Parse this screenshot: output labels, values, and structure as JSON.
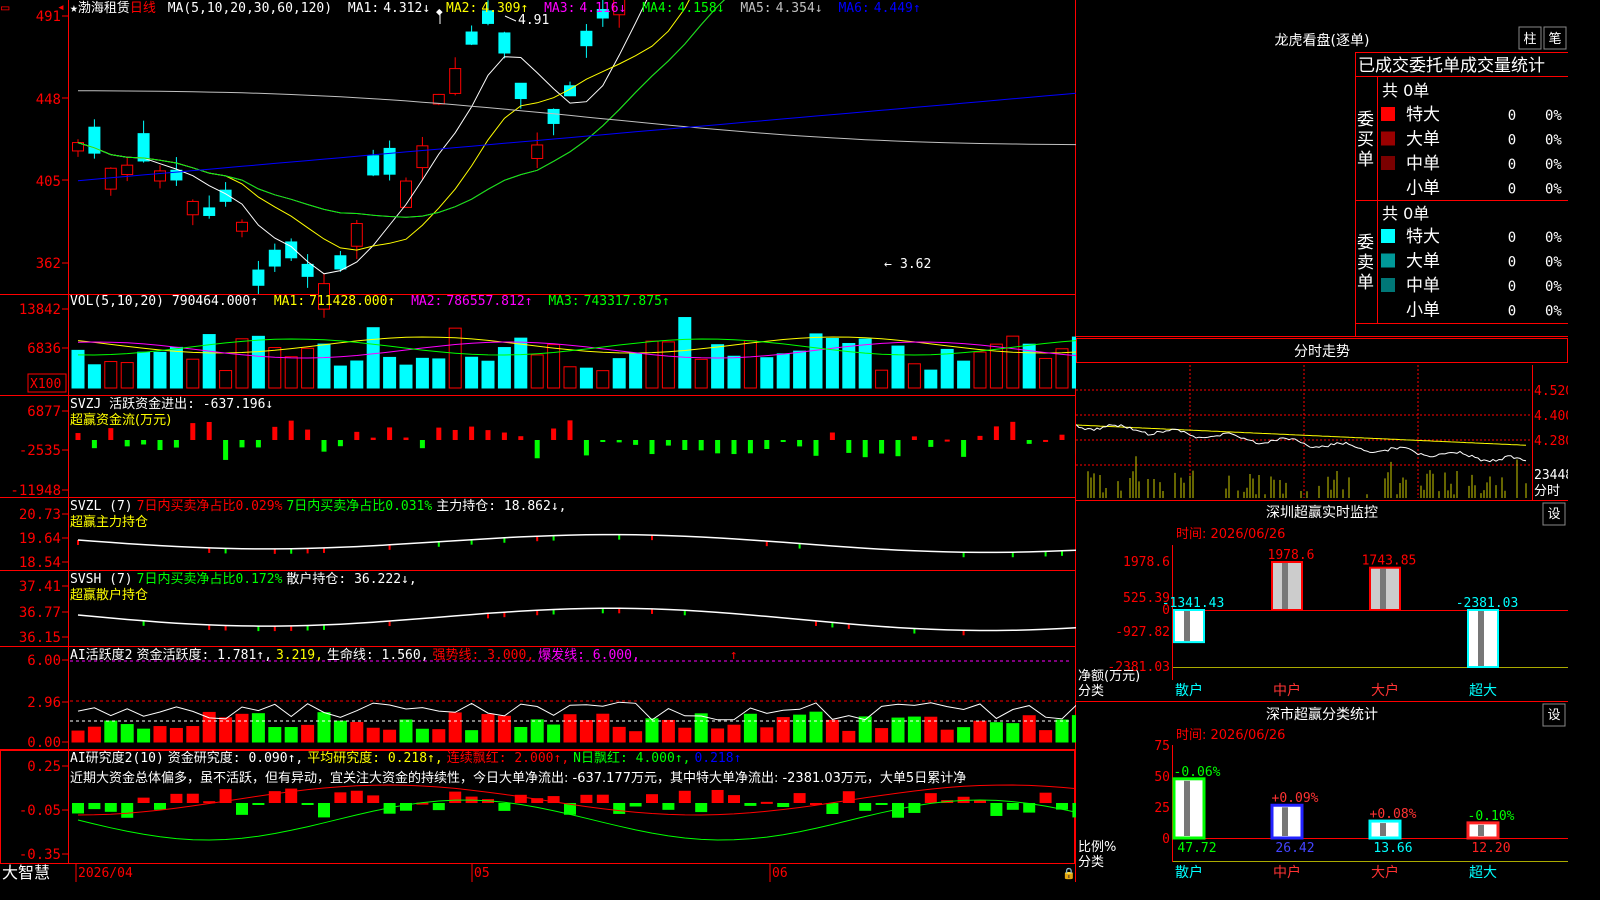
{
  "app": {
    "brand": "大智慧",
    "date_marker": "2026/04",
    "month_labels": [
      "05",
      "06"
    ],
    "star": "★"
  },
  "colors": {
    "up": "#ff0000",
    "down": "#00ffff",
    "ma1": "#ffffff",
    "ma2": "#ffff00",
    "ma3": "#ff00ff",
    "ma4": "#00ff00",
    "ma5": "#c0c0c0",
    "ma6": "#0000ff",
    "frame": "#ff0000",
    "axis": "#ff0000",
    "green": "#00ff00"
  },
  "main": {
    "title": "渤海租赁",
    "period": "日线",
    "ma_params": "MA(5,10,20,30,60,120)",
    "ma": [
      {
        "label": "MA1:",
        "value": "4.312↓"
      },
      {
        "label": "MA2:",
        "value": "4.309↑"
      },
      {
        "label": "MA3:",
        "value": "4.116↓"
      },
      {
        "label": "MA4:",
        "value": "4.158↓"
      },
      {
        "label": "MA5:",
        "value": "4.354↓"
      },
      {
        "label": "MA6:",
        "value": "4.449↑"
      }
    ],
    "y_ticks": [
      "491",
      "448",
      "405",
      "362"
    ],
    "high_label": "4.91",
    "low_label": "3.62"
  },
  "vol": {
    "title": "VOL(5,10,20)",
    "value": "790464.000↑",
    "ma": [
      {
        "label": "MA1:",
        "value": "711428.000↑"
      },
      {
        "label": "MA2:",
        "value": "786557.812↑"
      },
      {
        "label": "MA3:",
        "value": "743317.875↑"
      }
    ],
    "y_ticks": [
      "13842",
      "6836"
    ],
    "unit": "X100"
  },
  "svzj": {
    "line1": "SVZJ  活跃资金进出: -637.196↓",
    "line2": "超赢资金流(万元)",
    "y_ticks": [
      "6877",
      "-2535",
      "-11948"
    ]
  },
  "svzl": {
    "name": "SVZL (7)",
    "p1": "7日内买卖净占比0.029%",
    "p2": "7日内买卖净占比0.031%",
    "p3": "主力持仓: 18.862↓,",
    "line2": "超赢主力持仓",
    "y_ticks": [
      "20.73",
      "19.64",
      "18.54"
    ]
  },
  "svsh": {
    "name": "SVSH (7)",
    "p1": "7日内买卖净占比0.172%",
    "p2": "散户持仓: 36.222↓,",
    "line2": "超赢散户持仓",
    "y_ticks": [
      "37.41",
      "36.77",
      "36.15"
    ]
  },
  "ai1": {
    "name": "AI活跃度2",
    "p1": "资金活跃度: 1.781↑,",
    "p2": "3.219,",
    "p3": "生命线: 1.560,",
    "p4": "强势线: 3.000,",
    "p5": "爆发线: 6.000,",
    "p6": "↑",
    "y_ticks": [
      "6.00",
      "2.96",
      "0.00"
    ]
  },
  "ai2": {
    "name": "AI研究度2(10)",
    "p1": "资金研究度: 0.090↑,",
    "p2": "平均研究度: 0.218↑,",
    "p3": "连续飘红: 2.000↑,",
    "p4": "N日飘红: 4.000↑,",
    "p5": "0.218↑",
    "comment": "近期大资金总体偏多，虽不活跃，但有异动，宜关注大资金的持续性，今日大单净流出: -637.177万元，其中特大单净流出: -2381.03万元，大单5日累计净",
    "y_ticks": [
      "0.25",
      "-0.05",
      "-0.35"
    ]
  },
  "panel_lhb": {
    "title": "龙虎看盘(逐单)",
    "btn_zhu": "柱",
    "btn_bi": "笔",
    "subtitle": "已成交委托单成交量统计",
    "buy_label": "委买单",
    "sell_label": "委卖单",
    "buy_total": "共 0单",
    "sell_total": "共 0单",
    "buy_rows": [
      {
        "label": "特大",
        "count": "0",
        "pct": "0%",
        "color": "#ff0000"
      },
      {
        "label": "大单",
        "count": "0",
        "pct": "0%",
        "color": "#990000"
      },
      {
        "label": "中单",
        "count": "0",
        "pct": "0%",
        "color": "#7a0000"
      },
      {
        "label": "小单",
        "count": "0",
        "pct": "0%",
        "color": "#000000"
      }
    ],
    "sell_rows": [
      {
        "label": "特大",
        "count": "0",
        "pct": "0%",
        "color": "#00ffff"
      },
      {
        "label": "大单",
        "count": "0",
        "pct": "0%",
        "color": "#009999"
      },
      {
        "label": "中单",
        "count": "0",
        "pct": "0%",
        "color": "#007777"
      },
      {
        "label": "小单",
        "count": "0",
        "pct": "0%",
        "color": "#000000"
      }
    ]
  },
  "panel_fs": {
    "title": "分时走势",
    "prices": [
      "4.520",
      "4.400",
      "4.280"
    ],
    "volume": "23448",
    "vol_label": "分时"
  },
  "panel_sz": {
    "title": "深圳超赢实时监控",
    "settings": "设",
    "time": "时间: 2026/06/26",
    "y_ticks": [
      "1978.6",
      "525.39",
      "0",
      "-927.82",
      "-2381.03"
    ],
    "y_unit": "净额(万元)",
    "x_unit": "分类",
    "bars": [
      {
        "category": "散户",
        "label": "-1341.43",
        "value": -1341.43
      },
      {
        "category": "中户",
        "label": "1978.6",
        "value": 1978.6
      },
      {
        "category": "大户",
        "label": "1743.85",
        "value": 1743.85
      },
      {
        "category": "超大",
        "label": "-2381.03",
        "value": -2381.03
      }
    ]
  },
  "panel_ss": {
    "title": "深市超赢分类统计",
    "settings": "设",
    "time": "时间: 2026/06/26",
    "y_ticks": [
      "75",
      "50",
      "25",
      "0"
    ],
    "y_unit": "比例%",
    "x_unit": "分类",
    "bars": [
      {
        "category": "散户",
        "value": 47.72,
        "label": "47.72",
        "change": "-0.06%",
        "change_color": "#00ff00",
        "color": "#00ff00",
        "label_color": "#00ff00"
      },
      {
        "category": "中户",
        "value": 26.42,
        "label": "26.42",
        "change": "+0.09%",
        "change_color": "#ff3333",
        "color": "#2222ff",
        "label_color": "#4444ff"
      },
      {
        "category": "大户",
        "value": 13.66,
        "label": "13.66",
        "change": "+0.08%",
        "change_color": "#ff3333",
        "color": "#00ffff",
        "label_color": "#00ffff"
      },
      {
        "category": "超大",
        "value": 12.2,
        "label": "12.20",
        "change": "-0.10%",
        "change_color": "#00ff00",
        "color": "#ff2222",
        "label_color": "#ff2222"
      }
    ]
  },
  "chart_data": [
    {
      "type": "bar",
      "title": "深圳超赢实时监控",
      "categories": [
        "散户",
        "中户",
        "大户",
        "超大"
      ],
      "values": [
        -1341.43,
        1978.6,
        1743.85,
        -2381.03
      ],
      "ylabel": "净额(万元)",
      "xlabel": "分类",
      "ylim": [
        -2381.03,
        1978.6
      ]
    },
    {
      "type": "bar",
      "title": "深市超赢分类统计",
      "categories": [
        "散户",
        "中户",
        "大户",
        "超大"
      ],
      "values": [
        47.72,
        26.42,
        13.66,
        12.2
      ],
      "ylabel": "比例%",
      "xlabel": "分类",
      "ylim": [
        0,
        75
      ]
    }
  ]
}
